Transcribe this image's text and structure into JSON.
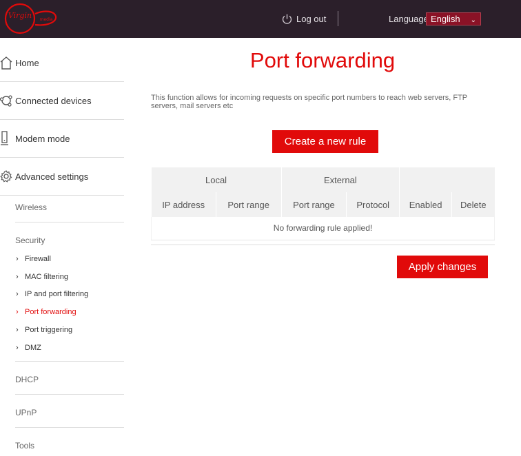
{
  "header": {
    "logo_text": "Virgin media",
    "logout_label": "Log out",
    "language_label": "Language",
    "language_value": "English"
  },
  "sidebar": {
    "main_items": [
      {
        "label": "Home",
        "icon": "home-icon"
      },
      {
        "label": "Connected devices",
        "icon": "devices-icon"
      },
      {
        "label": "Modem mode",
        "icon": "modem-icon"
      },
      {
        "label": "Advanced settings",
        "icon": "gear-icon"
      }
    ],
    "wireless": "Wireless",
    "security": "Security",
    "security_items": [
      {
        "label": "Firewall",
        "active": false
      },
      {
        "label": "MAC filtering",
        "active": false
      },
      {
        "label": "IP and port filtering",
        "active": false
      },
      {
        "label": "Port forwarding",
        "active": true
      },
      {
        "label": "Port triggering",
        "active": false
      },
      {
        "label": "DMZ",
        "active": false
      }
    ],
    "dhcp": "DHCP",
    "upnp": "UPnP",
    "tools": "Tools"
  },
  "main": {
    "title": "Port forwarding",
    "description": "This function allows for incoming requests on specific port numbers to reach web servers, FTP servers, mail servers etc",
    "create_button": "Create a new rule",
    "apply_button": "Apply changes",
    "table": {
      "group_local": "Local",
      "group_external": "External",
      "columns": [
        "IP address",
        "Port range",
        "Port range",
        "Protocol",
        "Enabled",
        "Delete"
      ],
      "empty_message": "No forwarding rule applied!"
    }
  },
  "colors": {
    "accent": "#e10a0a",
    "header_bg": "#2b1f2a",
    "language_select_bg": "#8a1226"
  }
}
